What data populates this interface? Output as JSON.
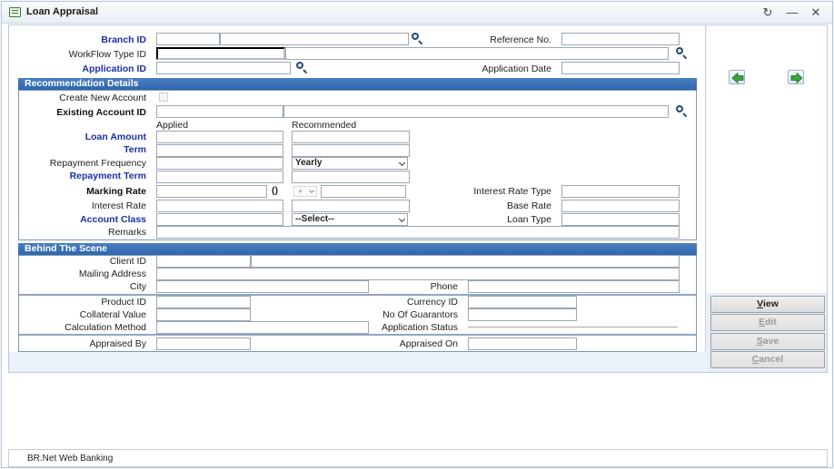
{
  "window": {
    "title": "Loan Appraisal",
    "refresh_glyph": "↻",
    "minimize_glyph": "—",
    "close_glyph": "✕"
  },
  "header_fields": {
    "branch_id": {
      "label": "Branch ID",
      "code": "",
      "name": ""
    },
    "reference_no": {
      "label": "Reference No.",
      "value": ""
    },
    "workflow_type_id": {
      "label": "WorkFlow Type ID",
      "code": "",
      "name": ""
    },
    "application_id": {
      "label": "Application ID",
      "value": ""
    },
    "application_date": {
      "label": "Application Date",
      "value": ""
    }
  },
  "recommendation": {
    "header": "Recommendation Details",
    "create_new_account": {
      "label": "Create New Account",
      "checked": false
    },
    "existing_account_id": {
      "label": "Existing Account ID",
      "code": "",
      "name": ""
    },
    "col_applied": "Applied",
    "col_recommended": "Recommended",
    "loan_amount": {
      "label": "Loan Amount",
      "applied": "",
      "recommended": ""
    },
    "term": {
      "label": "Term",
      "applied": "",
      "recommended": ""
    },
    "repayment_frequency": {
      "label": "Repayment Frequency",
      "applied": "",
      "recommended": "Yearly"
    },
    "repayment_term": {
      "label": "Repayment Term",
      "applied": "",
      "recommended": ""
    },
    "marking_rate": {
      "label": "Marking Rate",
      "value": "",
      "paren": "()",
      "sign": "+",
      "adjust": ""
    },
    "interest_rate_type": {
      "label": "Interest Rate Type",
      "value": ""
    },
    "interest_rate": {
      "label": "Interest Rate",
      "applied": "",
      "recommended": ""
    },
    "base_rate": {
      "label": "Base Rate",
      "value": ""
    },
    "account_class": {
      "label": "Account Class",
      "value": "",
      "selected": "--Select--"
    },
    "loan_type": {
      "label": "Loan Type",
      "value": ""
    },
    "remarks": {
      "label": "Remarks",
      "value": ""
    }
  },
  "behind_scene": {
    "header": "Behind The Scene",
    "client_id": {
      "label": "Client ID",
      "code": "",
      "name": ""
    },
    "mailing_address": {
      "label": "Mailing Address",
      "value": ""
    },
    "city": {
      "label": "City",
      "value": ""
    },
    "phone": {
      "label": "Phone",
      "value": ""
    },
    "product_id": {
      "label": "Product ID",
      "value": ""
    },
    "currency_id": {
      "label": "Currency ID",
      "value": ""
    },
    "collateral_value": {
      "label": "Collateral Value",
      "value": ""
    },
    "no_of_guarantors": {
      "label": "No Of Guarantors",
      "value": ""
    },
    "calculation_method": {
      "label": "Calculation Method",
      "value": ""
    },
    "application_status": {
      "label": "Application Status",
      "value": ""
    },
    "appraised_by": {
      "label": "Appraised By",
      "value": ""
    },
    "appraised_on": {
      "label": "Appraised On",
      "value": ""
    }
  },
  "actions": {
    "view": {
      "first": "V",
      "rest": "iew"
    },
    "edit": {
      "first": "E",
      "rest": "dit"
    },
    "save": {
      "first": "S",
      "rest": "ave"
    },
    "cancel": {
      "first": "C",
      "rest": "ancel"
    }
  },
  "colors": {
    "section_header": "#2f66ad",
    "required_label": "#1a30a8",
    "nav_arrow": "#3aa53a"
  },
  "status_bar": {
    "text": "BR.Net Web Banking"
  }
}
